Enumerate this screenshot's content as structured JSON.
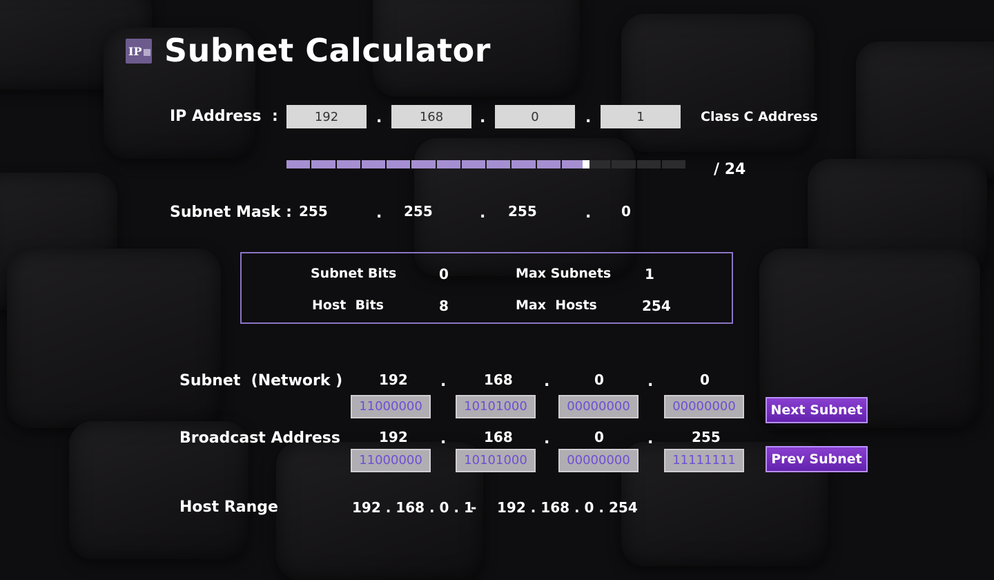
{
  "app": {
    "title": "Subnet Calculator",
    "logo_text": "IP"
  },
  "ip": {
    "label": "IP Address",
    "colon": ":",
    "octets": [
      "192",
      "168",
      "0",
      "1"
    ],
    "dot": ".",
    "class_text": "Class C Address"
  },
  "prefix": {
    "text": "/ 24",
    "value": 24,
    "max": 32
  },
  "mask": {
    "label": "Subnet Mask :",
    "octets": [
      "255",
      "255",
      "255",
      "0"
    ]
  },
  "info": {
    "subnet_bits_label": "Subnet Bits",
    "subnet_bits": "0",
    "max_subnets_label": "Max Subnets",
    "max_subnets": "1",
    "host_bits_label": "Host  Bits",
    "host_bits": "8",
    "max_hosts_label": "Max  Hosts",
    "max_hosts": "254"
  },
  "network": {
    "label": "Subnet  (Network )",
    "octets": [
      "192",
      "168",
      "0",
      "0"
    ],
    "binary": [
      "11000000",
      "10101000",
      "00000000",
      "00000000"
    ]
  },
  "broadcast": {
    "label": "Broadcast Address",
    "octets": [
      "192",
      "168",
      "0",
      "255"
    ],
    "binary": [
      "11000000",
      "10101000",
      "00000000",
      "11111111"
    ]
  },
  "host_range": {
    "label": "Host Range",
    "start": "192 . 168 . 0 . 1",
    "sep": "-",
    "end": "192 . 168 . 0 . 254"
  },
  "buttons": {
    "next": "Next Subnet",
    "prev": "Prev Subnet"
  },
  "colors": {
    "accent": "#8b75c4",
    "button": "#7030c0",
    "binary_text": "#6f4fd4"
  }
}
